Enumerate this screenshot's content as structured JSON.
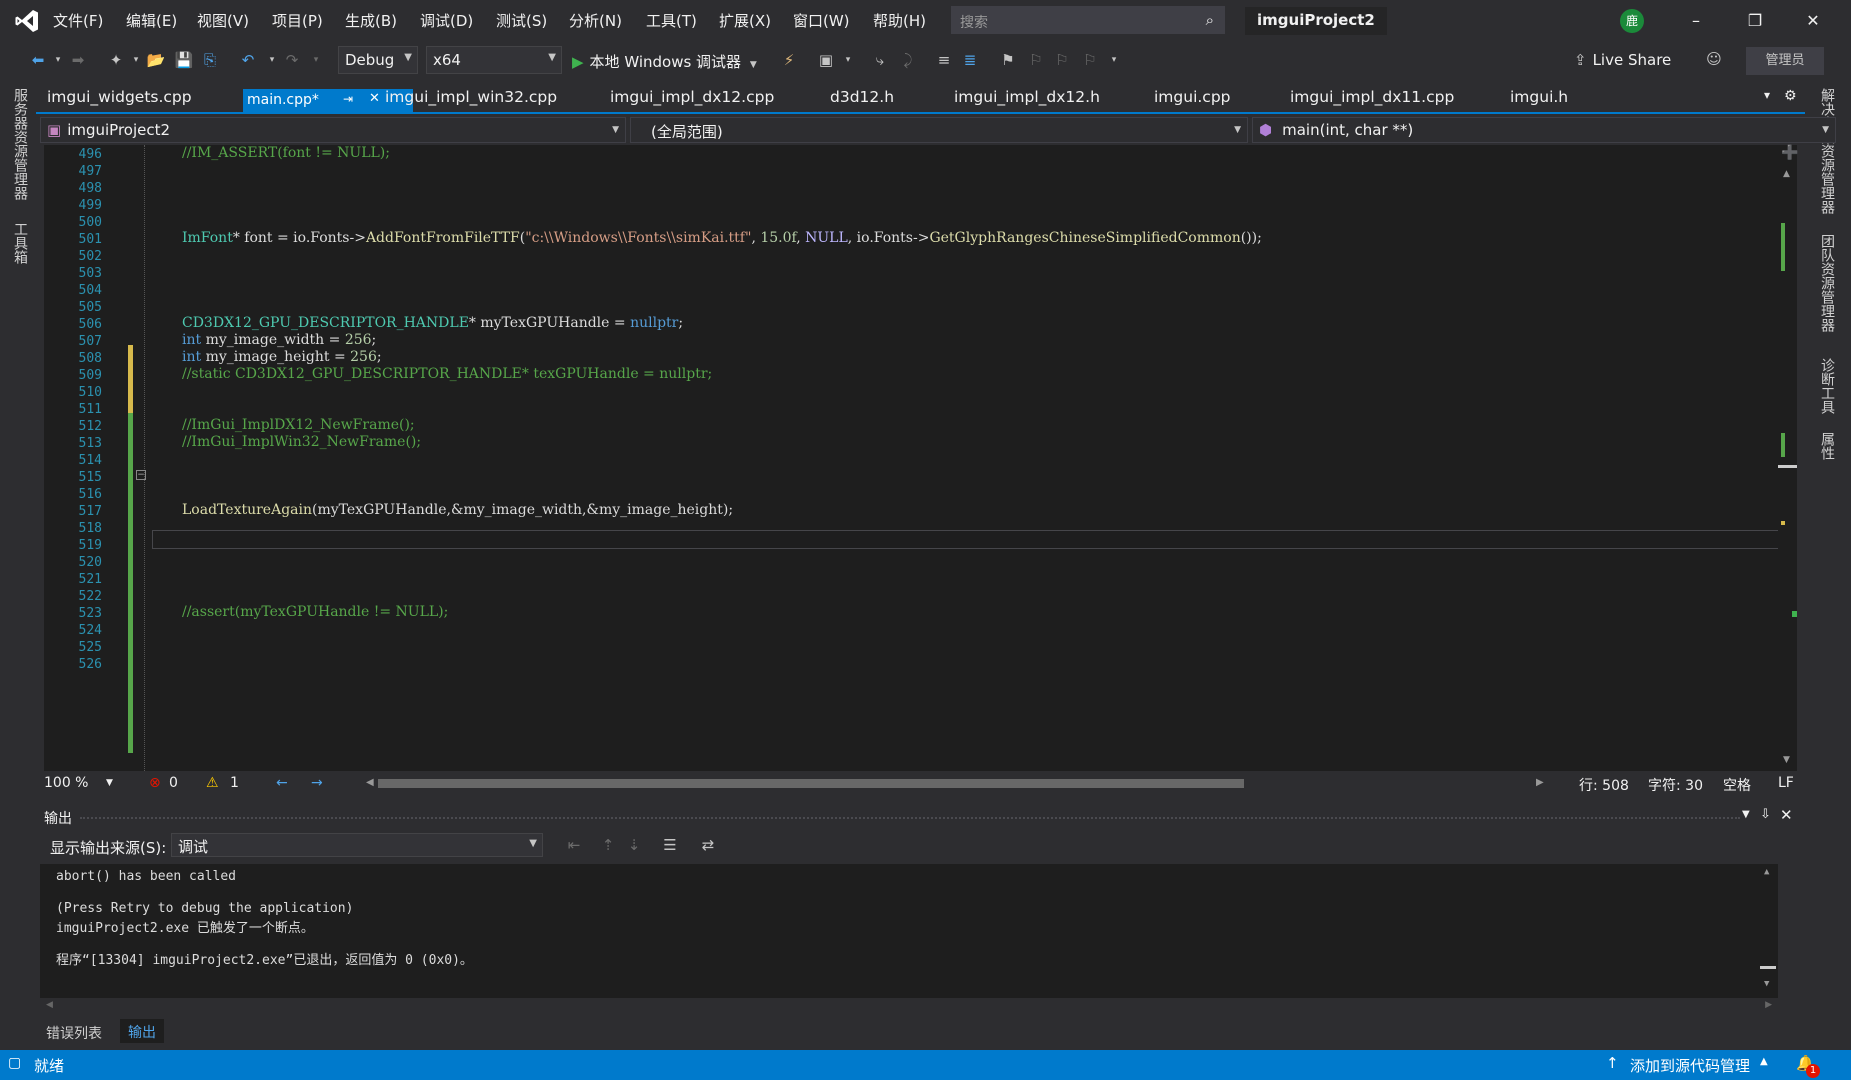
{
  "menu": [
    "文件(F)",
    "编辑(E)",
    "视图(V)",
    "项目(P)",
    "生成(B)",
    "调试(D)",
    "测试(S)",
    "分析(N)",
    "工具(T)",
    "扩展(X)",
    "窗口(W)",
    "帮助(H)"
  ],
  "search": {
    "placeholder": "搜索"
  },
  "project_title": "imguiProject2",
  "user_initial": "鹿",
  "toolbar": {
    "config": "Debug",
    "platform": "x64",
    "run_label": "本地 Windows 调试器",
    "live_share": "Live Share",
    "admin": "管理员"
  },
  "left_strip": [
    "服务器资源管理器",
    "工具箱"
  ],
  "right_strip": [
    "解决方案资源管理器",
    "团队资源管理器",
    "诊断工具",
    "属性"
  ],
  "tabs": [
    "imgui_widgets.cpp",
    "main.cpp*",
    "imgui_impl_win32.cpp",
    "imgui_impl_dx12.cpp",
    "d3d12.h",
    "imgui_impl_dx12.h",
    "imgui.cpp",
    "imgui_impl_dx11.cpp",
    "imgui.h"
  ],
  "nav": {
    "project": "imguiProject2",
    "scope": "(全局范围)",
    "member": "main(int, char **)"
  },
  "code_lines": [
    {
      "n": "496",
      "text": "//IM_ASSERT(font != NULL);"
    },
    {
      "n": "497",
      "text": ""
    },
    {
      "n": "498",
      "text": ""
    },
    {
      "n": "499",
      "text": ""
    },
    {
      "n": "500",
      "text": ""
    },
    {
      "n": "501",
      "text": "ImFont* font = io.Fonts->AddFontFromFileTTF(\"c:\\\\Windows\\\\Fonts\\\\simKai.ttf\", 15.0f, NULL, io.Fonts->GetGlyphRangesChineseSimplifiedCommon());"
    },
    {
      "n": "502",
      "text": ""
    },
    {
      "n": "503",
      "text": ""
    },
    {
      "n": "504",
      "text": ""
    },
    {
      "n": "505",
      "text": ""
    },
    {
      "n": "506",
      "text": "CD3DX12_GPU_DESCRIPTOR_HANDLE* myTexGPUHandle = nullptr;"
    },
    {
      "n": "507",
      "text": "int my_image_width = 256;"
    },
    {
      "n": "508",
      "text": "int my_image_height = 256;"
    },
    {
      "n": "509",
      "text": "//static CD3DX12_GPU_DESCRIPTOR_HANDLE* texGPUHandle = nullptr;"
    },
    {
      "n": "510",
      "text": ""
    },
    {
      "n": "511",
      "text": ""
    },
    {
      "n": "512",
      "text": "//ImGui_ImplDX12_NewFrame();"
    },
    {
      "n": "513",
      "text": "//ImGui_ImplWin32_NewFrame();"
    },
    {
      "n": "514",
      "text": ""
    },
    {
      "n": "515",
      "text": ""
    },
    {
      "n": "516",
      "text": ""
    },
    {
      "n": "517",
      "text": "LoadTextureAgain(myTexGPUHandle,&my_image_width,&my_image_height);"
    },
    {
      "n": "518",
      "text": ""
    },
    {
      "n": "519",
      "text": ""
    },
    {
      "n": "520",
      "text": ""
    },
    {
      "n": "521",
      "text": ""
    },
    {
      "n": "522",
      "text": ""
    },
    {
      "n": "523",
      "text": "//assert(myTexGPUHandle != NULL);"
    },
    {
      "n": "524",
      "text": ""
    },
    {
      "n": "525",
      "text": ""
    },
    {
      "n": "526",
      "text": ""
    }
  ],
  "editor_status": {
    "zoom": "100 %",
    "errors": "0",
    "warnings": "1",
    "line": "行: 508",
    "char": "字符: 30",
    "ws": "空格",
    "eol": "LF"
  },
  "output": {
    "title": "输出",
    "source_label": "显示输出来源(S):",
    "source_value": "调试",
    "lines": [
      "abort() has been called",
      "",
      "(Press Retry to debug the application)",
      "imguiProject2.exe 已触发了一个断点。",
      "",
      "程序“[13304] imguiProject2.exe”已退出，返回值为 0 (0x0)。"
    ]
  },
  "bottom_tabs": [
    "错误列表",
    "输出"
  ],
  "status": {
    "ready": "就绪",
    "source_control": "添加到源代码管理",
    "notifications": "1"
  }
}
